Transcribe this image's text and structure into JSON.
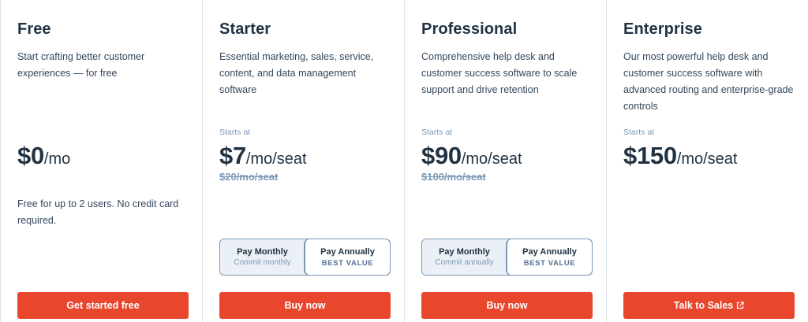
{
  "plans": [
    {
      "name": "Free",
      "description": "Start crafting better customer experiences — for free",
      "price": "$0",
      "unit": "/mo",
      "note": "Free for up to 2 users. No credit card required.",
      "cta": "Get started free"
    },
    {
      "name": "Starter",
      "description": "Essential marketing, sales, service, content, and data management software",
      "starts_at": "Starts at",
      "price": "$7",
      "unit": "/mo/seat",
      "old_price": "$20/mo/seat",
      "toggle": {
        "monthly_label": "Pay Monthly",
        "monthly_sub": "Commit monthly",
        "annual_label": "Pay Annually",
        "annual_sub": "BEST VALUE",
        "selected": "annually"
      },
      "cta": "Buy now"
    },
    {
      "name": "Professional",
      "description": "Comprehensive help desk and customer success software to scale support and drive retention",
      "starts_at": "Starts at",
      "price": "$90",
      "unit": "/mo/seat",
      "old_price": "$100/mo/seat",
      "toggle": {
        "monthly_label": "Pay Monthly",
        "monthly_sub": "Commit annually",
        "annual_label": "Pay Annually",
        "annual_sub": "BEST VALUE",
        "selected": "annually"
      },
      "cta": "Buy now"
    },
    {
      "name": "Enterprise",
      "description": "Our most powerful help desk and customer success software with advanced routing and enterprise-grade controls",
      "starts_at": "Starts at",
      "price": "$150",
      "unit": "/mo/seat",
      "cta": "Talk to Sales",
      "cta_icon": "external-link-icon"
    }
  ],
  "colors": {
    "accent": "#e8472d",
    "text": "#213343",
    "muted": "#7c98b6",
    "divider": "#dfe3eb"
  }
}
